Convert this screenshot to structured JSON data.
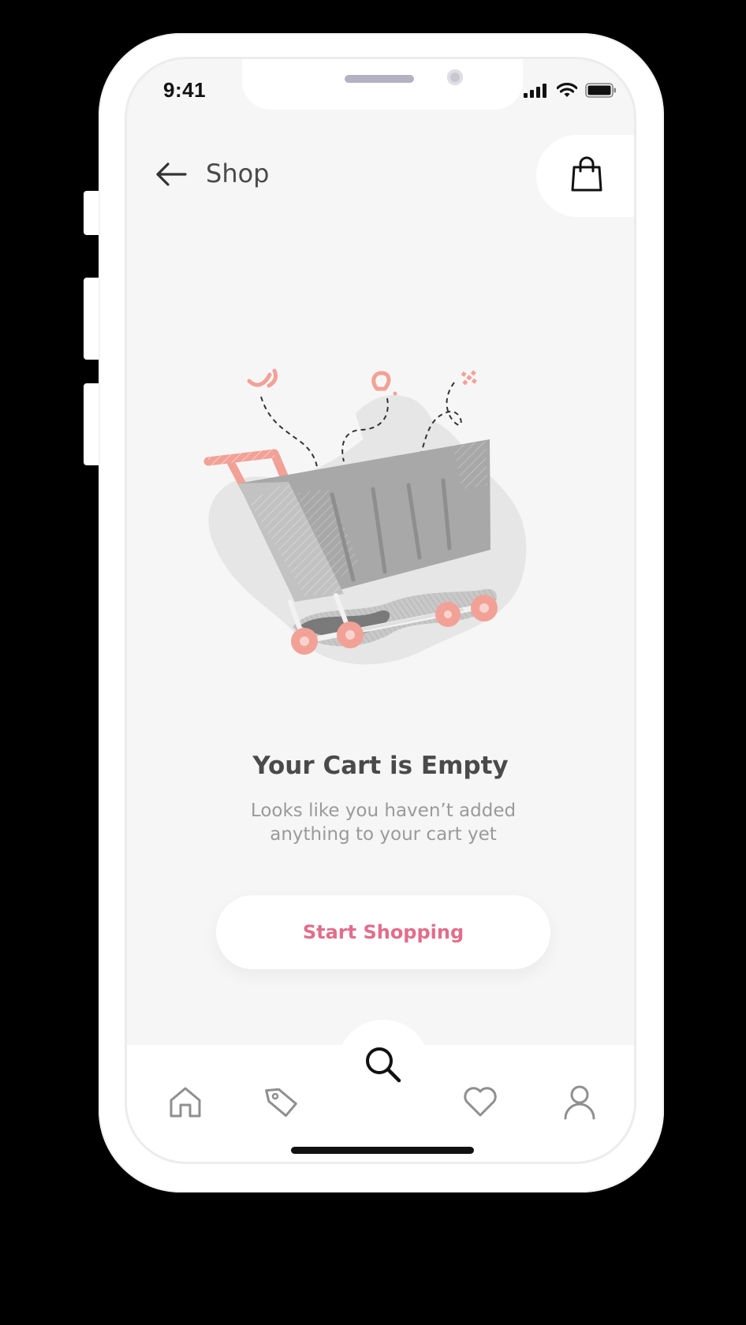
{
  "status_bar": {
    "time": "9:41"
  },
  "header": {
    "back_icon": "arrow-left-icon",
    "title": "Shop",
    "bag_icon": "shopping-bag-icon"
  },
  "empty_state": {
    "illustration": "empty-shopping-cart-illustration",
    "title": "Your Cart is Empty",
    "subtitle_line1": "Looks like you haven’t added",
    "subtitle_line2": "anything to your cart yet",
    "button_label": "Start Shopping"
  },
  "tab_bar": {
    "items": [
      {
        "icon": "home-icon"
      },
      {
        "icon": "tag-icon"
      },
      {
        "icon": "search-icon",
        "active": true
      },
      {
        "icon": "heart-icon"
      },
      {
        "icon": "user-icon"
      }
    ]
  },
  "colors": {
    "accent": "#e26d8a",
    "illustration_accent": "#f2a197",
    "background": "#f6f6f6",
    "text_dark": "#4a4a4a",
    "text_muted": "#9a9a9a"
  }
}
